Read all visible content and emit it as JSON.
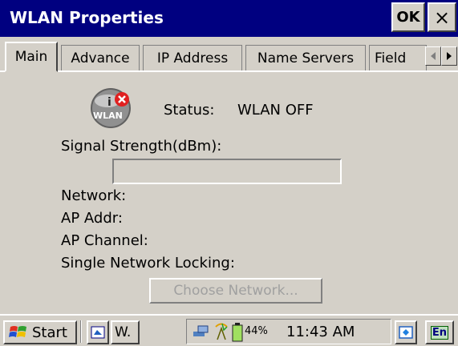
{
  "window": {
    "title": "WLAN Properties",
    "ok_label": "OK",
    "close_label": "×"
  },
  "tabs": [
    {
      "label": "Main"
    },
    {
      "label": "Advance"
    },
    {
      "label": "IP Address"
    },
    {
      "label": "Name Servers"
    },
    {
      "label": "Field"
    }
  ],
  "main": {
    "status_label": "Status:",
    "status_value": "WLAN OFF",
    "signal_strength_label": "Signal Strength(dBm):",
    "network_label": "Network:",
    "ap_addr_label": "AP Addr:",
    "ap_channel_label": "AP Channel:",
    "single_network_locking_label": "Single Network Locking:",
    "choose_network_button": "Choose Network..."
  },
  "taskbar": {
    "start_label": "Start",
    "window_button_label": "W.",
    "battery_percent": "44%",
    "time": "11:43 AM",
    "ime_label": "En"
  },
  "colors": {
    "titlebar": "#000080",
    "face": "#d4d0c8",
    "disabled_text": "#a0a0a0"
  }
}
